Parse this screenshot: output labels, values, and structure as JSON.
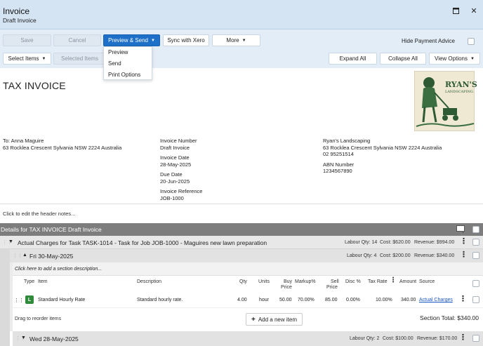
{
  "window": {
    "title": "Invoice",
    "subtitle": "Draft Invoice"
  },
  "toolbar": {
    "save": "Save",
    "cancel": "Cancel",
    "preview_send": "Preview & Send",
    "sync": "Sync with Xero",
    "more": "More",
    "hide_payment": "Hide Payment Advice",
    "select_items": "Select Items",
    "selected_items": "Selected Items",
    "expand_all": "Expand All",
    "collapse_all": "Collapse All",
    "view_options": "View Options"
  },
  "dropdown": {
    "items": [
      "Preview",
      "Send",
      "Print Options"
    ]
  },
  "document": {
    "title": "TAX INVOICE",
    "to_line": "To: Anna Maguire",
    "to_address": "63 Rocklea Crescent Sylvania NSW 2224 Australia",
    "invoice_number_label": "Invoice Number",
    "invoice_number": "Draft Invoice",
    "invoice_date_label": "Invoice Date",
    "invoice_date": "28-May-2025",
    "due_date_label": "Due Date",
    "due_date": "20-Jun-2025",
    "reference_label": "Invoice Reference",
    "reference": "JOB-1000",
    "company_name": "Ryan's Landscaping",
    "company_address": "63 Rocklea Crescent Sylvania NSW 2224 Australia",
    "company_phone": "02 95251514",
    "abn_label": "ABN Number",
    "abn": "1234567890",
    "logo_text_1": "RYAN'S",
    "logo_text_2": "LANDSCAPING",
    "header_notes": "Click to edit the header notes..."
  },
  "details": {
    "bar_title": "Details for TAX INVOICE Draft Invoice",
    "task": {
      "label": "Actual Charges for Task TASK-1014 - Task for Job JOB-1000 - Maguires new lawn preparation",
      "labour": "Labour Qty: 14",
      "cost": "Cost: $620.00",
      "revenue": "Revenue: $994.00"
    },
    "section1": {
      "date": "Fri 30-May-2025",
      "labour": "Labour Qty: 4",
      "cost": "Cost: $200.00",
      "revenue": "Revenue: $340.00",
      "desc_placeholder": "Click here to add a section description..."
    },
    "columns": {
      "type": "Type",
      "item": "Item",
      "description": "Description",
      "qty": "Qty",
      "units": "Units",
      "buy_price_1": "Buy",
      "buy_price_2": "Price",
      "markup": "Markup%",
      "sell_price_1": "Sell",
      "sell_price_2": "Price",
      "disc": "Disc %",
      "tax_rate": "Tax Rate",
      "amount": "Amount",
      "source": "Source"
    },
    "item": {
      "type_badge": "L",
      "item": "Standard Hourly Rate",
      "description": "Standard hourly rate.",
      "qty": "4.00",
      "units": "hour",
      "buy_price": "50.00",
      "markup": "70.00%",
      "sell_price": "85.00",
      "disc": "0.00%",
      "tax_rate": "10.00%",
      "amount": "340.00",
      "source": "Actual Charges"
    },
    "drag_hint": "Drag to reorder items",
    "add_item": "Add a new item",
    "section_total": "Section Total: $340.00",
    "section2": {
      "date": "Wed 28-May-2025",
      "labour": "Labour Qty: 2",
      "cost": "Cost: $100.00",
      "revenue": "Revenue: $170.00"
    }
  }
}
